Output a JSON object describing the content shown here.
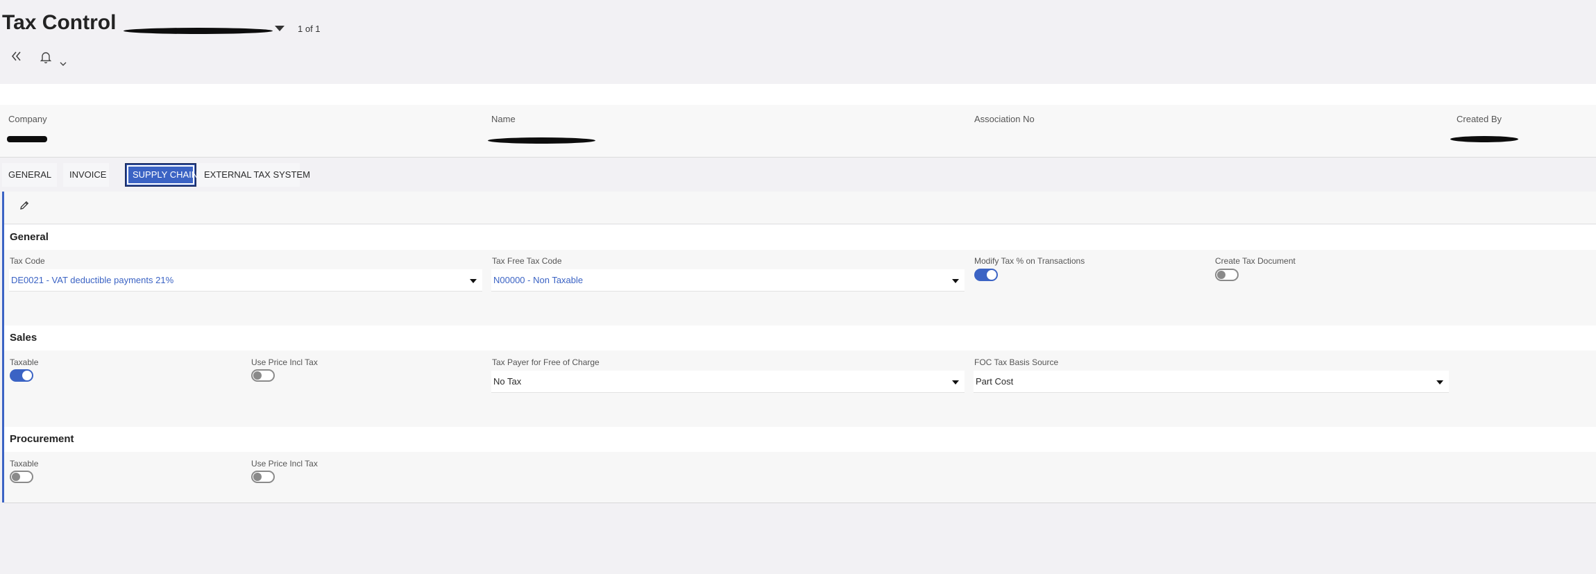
{
  "page": {
    "title": "Tax Control",
    "record_counter": "1 of 1"
  },
  "toolbar": {
    "collapse_icon": "double-chevron-left-icon",
    "notifications_icon": "bell-icon",
    "notifications_dropdown_icon": "chevron-down-icon"
  },
  "summary": {
    "company_label": "Company",
    "name_label": "Name",
    "association_label": "Association No",
    "created_by_label": "Created By"
  },
  "tabs": [
    {
      "label": "GENERAL",
      "active": false
    },
    {
      "label": "INVOICE",
      "active": false
    },
    {
      "label": "SUPPLY CHAIN",
      "active": true
    },
    {
      "label": "EXTERNAL TAX SYSTEM",
      "active": false
    }
  ],
  "edit_icon": "pencil-icon",
  "general": {
    "title": "General",
    "tax_code_label": "Tax Code",
    "tax_code_value": "DE0021 - VAT deductible payments 21%",
    "tax_free_label": "Tax Free Tax Code",
    "tax_free_value": "N00000 - Non Taxable",
    "modify_tax_label": "Modify Tax % on Transactions",
    "modify_tax_on": true,
    "create_doc_label": "Create Tax Document",
    "create_doc_on": false
  },
  "sales": {
    "title": "Sales",
    "taxable_label": "Taxable",
    "taxable_on": true,
    "price_incl_label": "Use Price Incl Tax",
    "price_incl_on": false,
    "tax_payer_label": "Tax Payer for Free of Charge",
    "tax_payer_value": "No Tax",
    "foc_label": "FOC Tax Basis Source",
    "foc_value": "Part Cost"
  },
  "procurement": {
    "title": "Procurement",
    "taxable_label": "Taxable",
    "taxable_on": false,
    "price_incl_label": "Use Price Incl Tax",
    "price_incl_on": false
  },
  "colors": {
    "accent": "#3b63c4",
    "background": "#f2f1f4"
  }
}
